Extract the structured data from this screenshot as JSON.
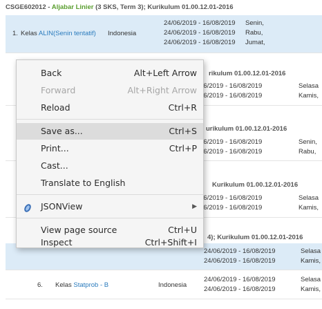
{
  "page": {
    "header1": {
      "code": "CSGE602012 - ",
      "name": "Aljabar Linier",
      "rest": " (3 SKS, Term 3); Kurikulum 01.00.12.01-2016"
    },
    "row1": {
      "num": "1.",
      "prefix": "Kelas ",
      "class": "ALIN(Senin tentatif)",
      "lang": "Indonesia",
      "dates": [
        "24/06/2019 - 16/08/2019",
        "24/06/2019 - 16/08/2019",
        "24/06/2019 - 16/08/2019"
      ],
      "days": [
        "Senin,",
        "Rabu,",
        "Jumat,"
      ]
    },
    "header2": "rikulum 01.00.12.01-2016",
    "block2": {
      "dates": [
        "06/2019 - 16/08/2019",
        "06/2019 - 16/08/2019"
      ],
      "days": [
        "Selasa",
        "Kamis,"
      ]
    },
    "header3": "urikulum 01.00.12.01-2016",
    "block3": {
      "dates": [
        "06/2019 - 16/08/2019",
        "06/2019 - 16/08/2019"
      ],
      "days": [
        "Senin,",
        "Rabu,"
      ]
    },
    "header4": "Kurikulum 01.00.12.01-2016",
    "block4": {
      "dates": [
        "06/2019 - 16/08/2019",
        "06/2019 - 16/08/2019"
      ],
      "days": [
        "Selasa",
        "Kamis,"
      ]
    },
    "header5": "4); Kurikulum 01.00.12.01-2016",
    "block5": {
      "dates": [
        "24/06/2019 - 16/08/2019",
        "24/06/2019 - 16/08/2019"
      ],
      "days": [
        "Selasa",
        "Kamis,"
      ]
    },
    "row6": {
      "num": "6.",
      "prefix": "Kelas ",
      "class": "Statprob - B",
      "lang": "Indonesia",
      "dates": [
        "24/06/2019 - 16/08/2019",
        "24/06/2019 - 16/08/2019"
      ],
      "days": [
        "Selasa",
        "Kamis,"
      ]
    }
  },
  "menu": {
    "back": {
      "label": "Back",
      "shortcut": "Alt+Left Arrow"
    },
    "forward": {
      "label": "Forward",
      "shortcut": "Alt+Right Arrow"
    },
    "reload": {
      "label": "Reload",
      "shortcut": "Ctrl+R"
    },
    "save_as": {
      "label": "Save as...",
      "shortcut": "Ctrl+S"
    },
    "print": {
      "label": "Print...",
      "shortcut": "Ctrl+P"
    },
    "cast": {
      "label": "Cast..."
    },
    "translate": {
      "label": "Translate to English"
    },
    "jsonview": {
      "label": "JSONView",
      "icon": "jsonview-extension-icon"
    },
    "view_source": {
      "label": "View page source",
      "shortcut": "Ctrl+U"
    },
    "inspect": {
      "label": "Inspect",
      "shortcut": "Ctrl+Shift+I"
    }
  },
  "colors": {
    "accent_link": "#2a7bbd",
    "course_name": "#5a9e2f",
    "row_highlight": "#dcebf7",
    "menu_hover": "#dcdcdc"
  }
}
